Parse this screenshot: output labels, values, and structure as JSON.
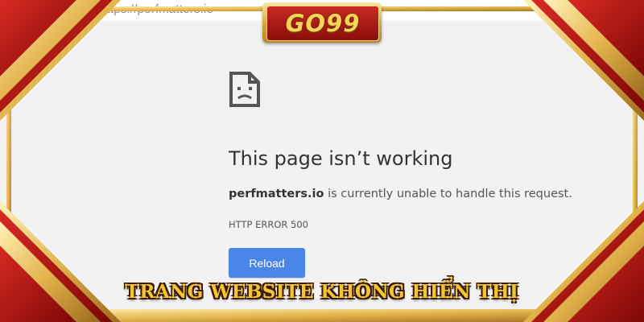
{
  "browser": {
    "url": "https://perfmatters.io"
  },
  "error_page": {
    "icon": "sad-page-icon",
    "title": "This page isn’t working",
    "domain": "perfmatters.io",
    "description": " is currently unable to handle this request.",
    "error_code": "HTTP ERROR 500",
    "reload_label": "Reload"
  },
  "overlay": {
    "logo_text": "GO99",
    "logo_icon": "star-icon",
    "caption": "TRANG WEBSITE KHÔNG HIỂN THỊ"
  },
  "colors": {
    "button_blue": "#4a86e8",
    "frame_red": "#b3120f",
    "frame_gold": "#e8c15a",
    "caption_gold": "#f5c531"
  }
}
